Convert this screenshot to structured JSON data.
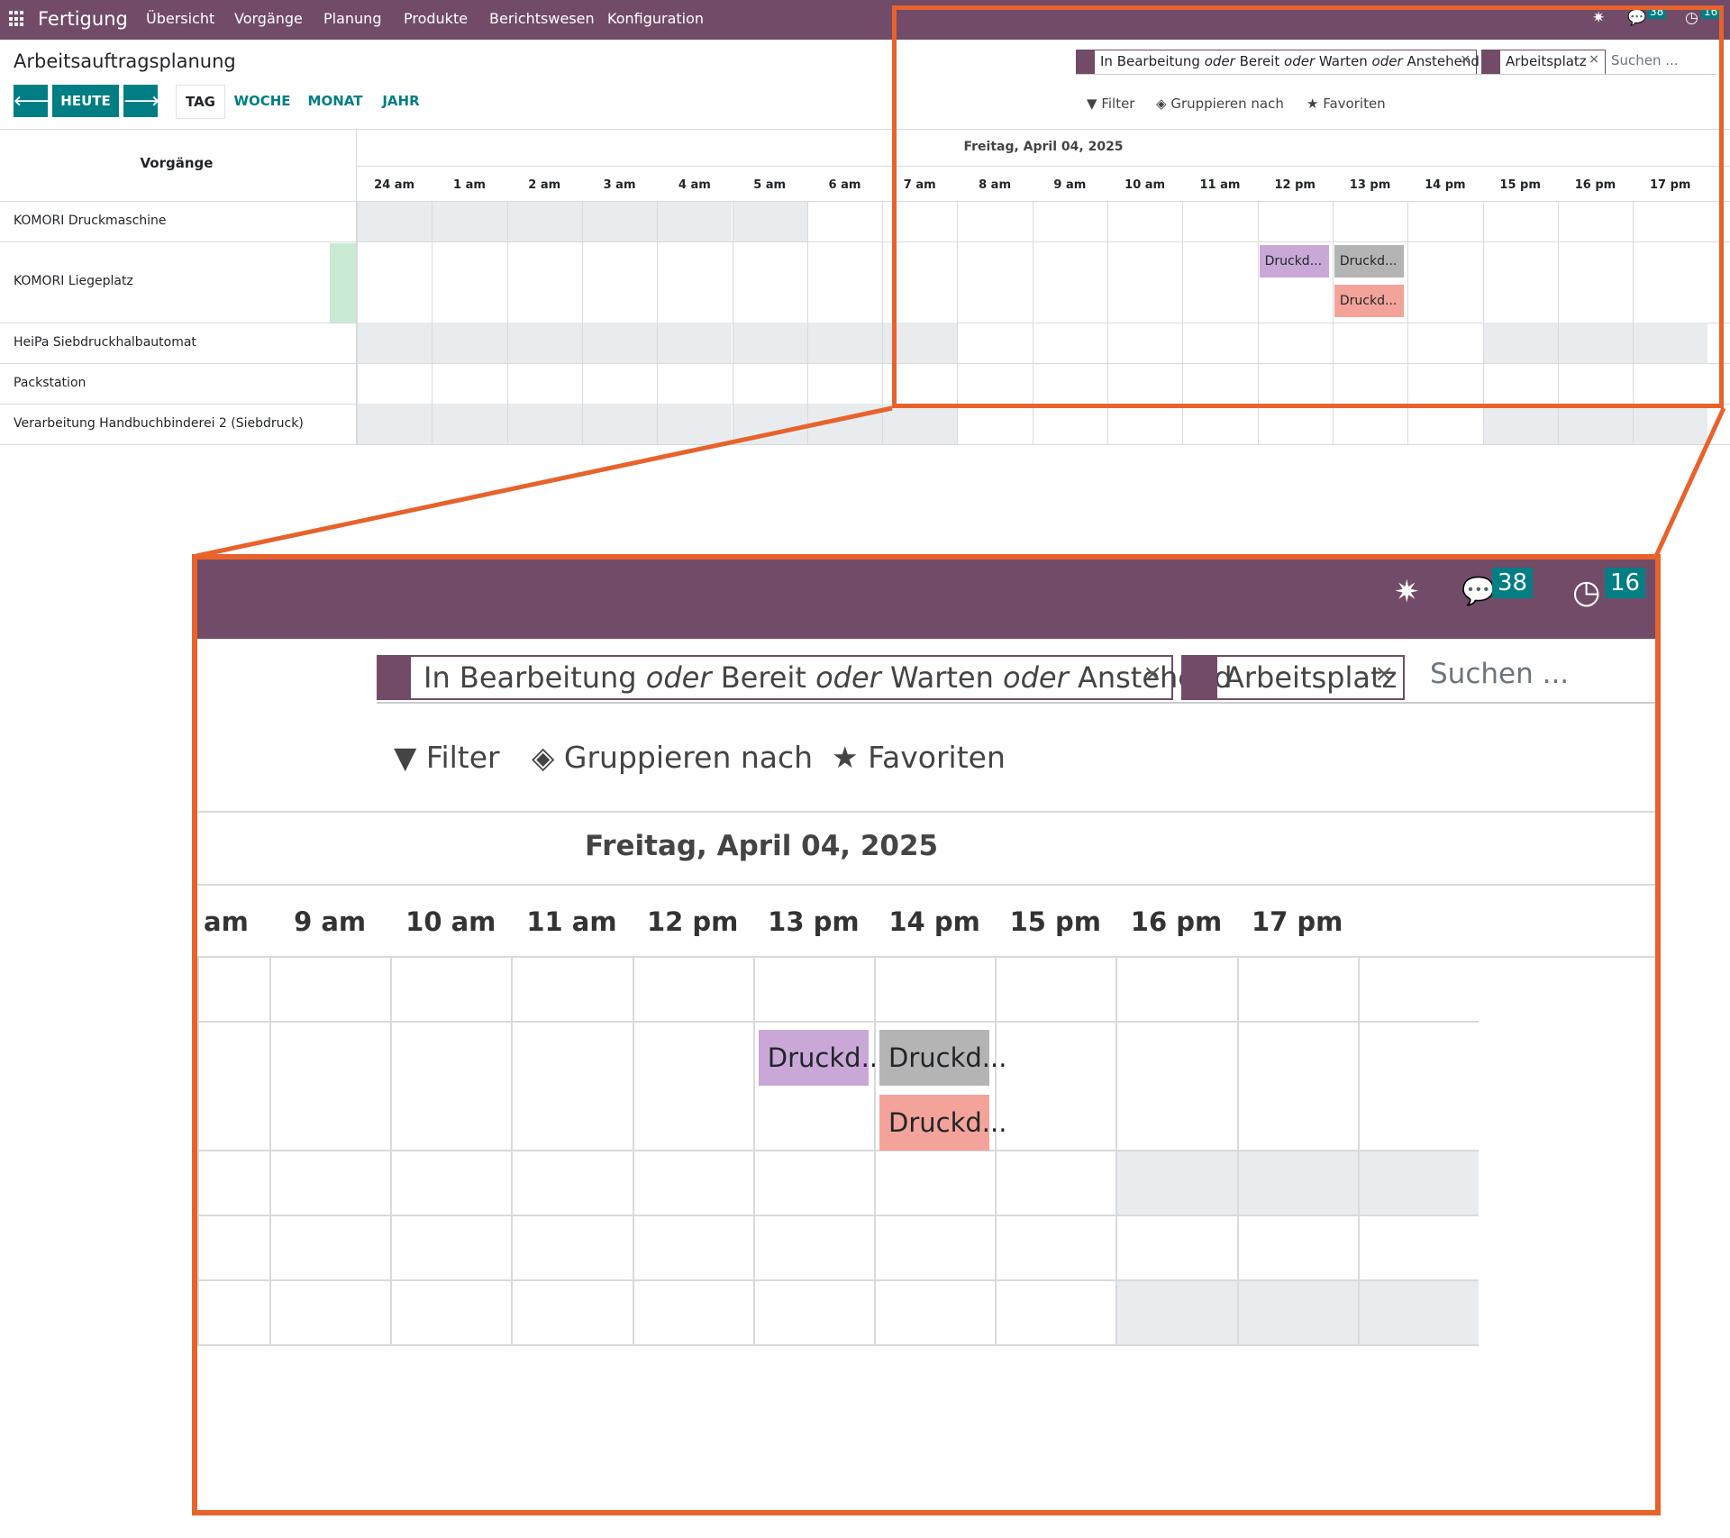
{
  "navbar": {
    "app_name": "Fertigung",
    "menu": [
      "Übersicht",
      "Vorgänge",
      "Planung",
      "Produkte",
      "Berichtswesen",
      "Konfiguration"
    ],
    "messages_count": "38",
    "activities_count": "16"
  },
  "control": {
    "title": "Arbeitsauftragsplanung",
    "prev_icon": "arrow-left-icon",
    "today_label": "HEUTE",
    "next_icon": "arrow-right-icon",
    "scales": [
      "TAG",
      "WOCHE",
      "MONAT",
      "JAHR"
    ],
    "active_scale": "TAG"
  },
  "search": {
    "filter_facet_parts": [
      "In Bearbeitung",
      "oder",
      "Bereit",
      "oder",
      "Warten",
      "oder",
      "Anstehend"
    ],
    "group_facet": "Arbeitsplatz",
    "placeholder": "Suchen ...",
    "filter_label": "Filter",
    "group_label": "Gruppieren nach",
    "favorites_label": "Favoriten"
  },
  "gantt": {
    "rows_header": "Vorgänge",
    "date_title": "Freitag, April 04, 2025",
    "hours": [
      "24 am",
      "1 am",
      "2 am",
      "3 am",
      "4 am",
      "5 am",
      "6 am",
      "7 am",
      "8 am",
      "9 am",
      "10 am",
      "11 am",
      "12 pm",
      "13 pm",
      "14 pm",
      "15 pm",
      "16 pm",
      "17 pm"
    ],
    "rows": [
      {
        "label": "KOMORI Druckmaschine"
      },
      {
        "label": "KOMORI Liegeplatz"
      },
      {
        "label": "HeiPa Siebdruckhalbautomat"
      },
      {
        "label": "Packstation"
      },
      {
        "label": "Verarbeitung Handbuchbinderei 2 (Siebdruck)"
      }
    ],
    "pills": [
      {
        "label": "Druckd...",
        "row": "KOMORI Liegeplatz",
        "hour": "12 pm",
        "color": "#c9a8d8"
      },
      {
        "label": "Druckd...",
        "row": "KOMORI Liegeplatz",
        "hour": "13 pm",
        "color": "#b4b4b4"
      },
      {
        "label": "Druckd...",
        "row": "KOMORI Liegeplatz",
        "hour": "13 pm",
        "color": "#f4a39a"
      }
    ]
  },
  "zoom": {
    "hours": [
      "am",
      "9 am",
      "10 am",
      "11 am",
      "12 pm",
      "13 pm",
      "14 pm",
      "15 pm",
      "16 pm",
      "17 pm"
    ],
    "accent": "#e8622c"
  }
}
